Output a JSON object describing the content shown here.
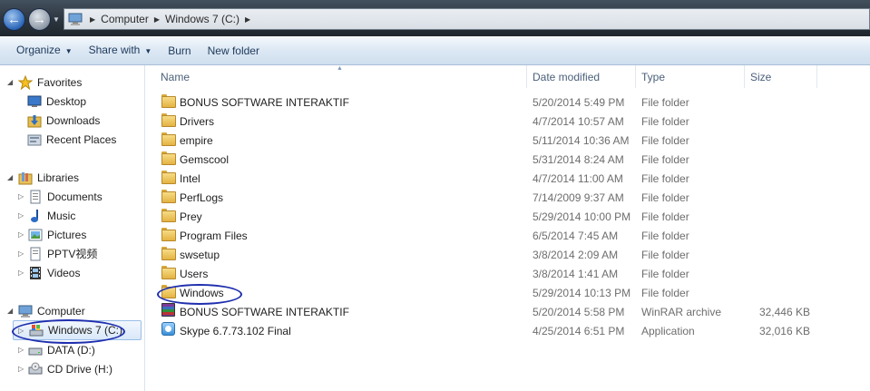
{
  "address": {
    "crumbs": [
      "Computer",
      "Windows 7 (C:)"
    ]
  },
  "toolbar": {
    "organize": "Organize",
    "share_with": "Share with",
    "burn": "Burn",
    "new_folder": "New folder"
  },
  "nav": {
    "favorites": "Favorites",
    "desktop": "Desktop",
    "downloads": "Downloads",
    "recent": "Recent Places",
    "libraries": "Libraries",
    "documents": "Documents",
    "music": "Music",
    "pictures": "Pictures",
    "pptv": "PPTV视频",
    "videos": "Videos",
    "computer": "Computer",
    "win7": "Windows 7 (C:)",
    "data": "DATA (D:)",
    "cd": "CD Drive (H:)"
  },
  "columns": {
    "name": "Name",
    "date": "Date modified",
    "type": "Type",
    "size": "Size"
  },
  "files": [
    {
      "name": "BONUS SOFTWARE INTERAKTIF",
      "date": "5/20/2014 5:49 PM",
      "type": "File folder",
      "size": "",
      "icon": "folder-icon"
    },
    {
      "name": "Drivers",
      "date": "4/7/2014 10:57 AM",
      "type": "File folder",
      "size": "",
      "icon": "folder-icon"
    },
    {
      "name": "empire",
      "date": "5/11/2014 10:36 AM",
      "type": "File folder",
      "size": "",
      "icon": "folder-icon"
    },
    {
      "name": "Gemscool",
      "date": "5/31/2014 8:24 AM",
      "type": "File folder",
      "size": "",
      "icon": "folder-icon"
    },
    {
      "name": "Intel",
      "date": "4/7/2014 11:00 AM",
      "type": "File folder",
      "size": "",
      "icon": "folder-icon"
    },
    {
      "name": "PerfLogs",
      "date": "7/14/2009 9:37 AM",
      "type": "File folder",
      "size": "",
      "icon": "folder-icon"
    },
    {
      "name": "Prey",
      "date": "5/29/2014 10:00 PM",
      "type": "File folder",
      "size": "",
      "icon": "folder-icon"
    },
    {
      "name": "Program Files",
      "date": "6/5/2014 7:45 AM",
      "type": "File folder",
      "size": "",
      "icon": "folder-icon"
    },
    {
      "name": "swsetup",
      "date": "3/8/2014 2:09 AM",
      "type": "File folder",
      "size": "",
      "icon": "folder-icon"
    },
    {
      "name": "Users",
      "date": "3/8/2014 1:41 AM",
      "type": "File folder",
      "size": "",
      "icon": "folder-icon"
    },
    {
      "name": "Windows",
      "date": "5/29/2014 10:13 PM",
      "type": "File folder",
      "size": "",
      "icon": "folder-icon"
    },
    {
      "name": "BONUS SOFTWARE INTERAKTIF",
      "date": "5/20/2014 5:58 PM",
      "type": "WinRAR archive",
      "size": "32,446 KB",
      "icon": "winrar-icon"
    },
    {
      "name": "Skype 6.7.73.102 Final",
      "date": "4/25/2014 6:51 PM",
      "type": "Application",
      "size": "32,016 KB",
      "icon": "skype-icon"
    }
  ],
  "colors": {
    "highlight_ellipse": "#1f2fae",
    "toolbar_text": "#1e395b",
    "selected_nav_bg": "#d9e8f9"
  }
}
